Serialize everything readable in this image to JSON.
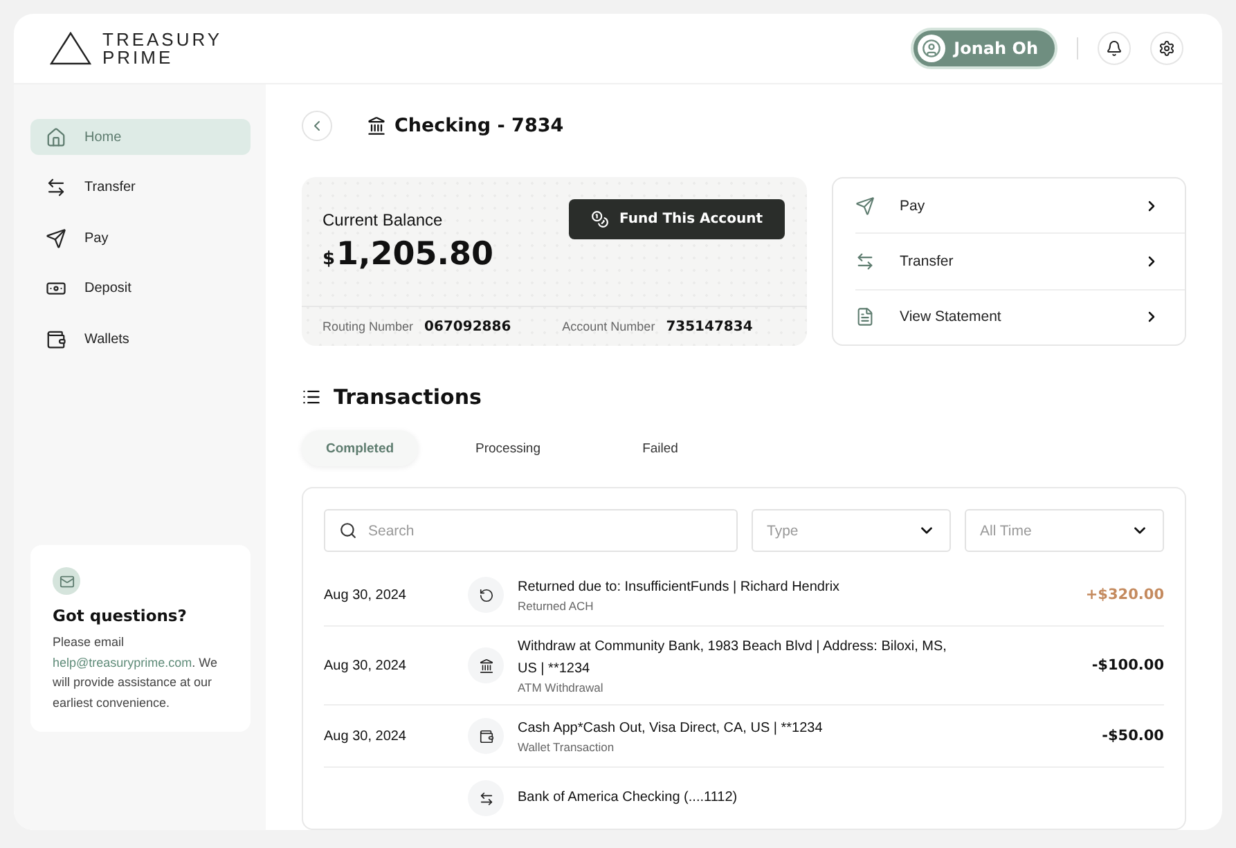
{
  "brand": {
    "line1": "TREASURY",
    "line2": "PRIME"
  },
  "user": {
    "name": "Jonah Oh"
  },
  "sidebar": {
    "items": [
      {
        "label": "Home",
        "kind": "home",
        "selected": true
      },
      {
        "label": "Transfer",
        "kind": "transfer",
        "selected": false
      },
      {
        "label": "Pay",
        "kind": "send",
        "selected": false
      },
      {
        "label": "Deposit",
        "kind": "deposit",
        "selected": false
      },
      {
        "label": "Wallets",
        "kind": "wallet",
        "selected": false
      }
    ],
    "help": {
      "title": "Got questions?",
      "before": "Please email",
      "link": "help@treasuryprime.com",
      "after": ". We will provide assistance at our earliest convenience."
    }
  },
  "account": {
    "title": "Checking - 7834",
    "balance_label": "Current Balance",
    "currency": "$",
    "balance": "1,205.80",
    "fund_button": "Fund This Account",
    "routing_label": "Routing Number",
    "routing": "067092886",
    "account_label": "Account Number",
    "account": "735147834"
  },
  "actions": [
    {
      "label": "Pay",
      "kind": "send"
    },
    {
      "label": "Transfer",
      "kind": "transfer"
    },
    {
      "label": "View Statement",
      "kind": "file"
    }
  ],
  "transactions": {
    "title": "Transactions",
    "tabs": [
      {
        "label": "Completed",
        "selected": true
      },
      {
        "label": "Processing",
        "selected": false
      },
      {
        "label": "Failed",
        "selected": false
      }
    ],
    "search": {
      "placeholder": "Search"
    },
    "filters": [
      {
        "placeholder": "Type"
      },
      {
        "placeholder": "All Time"
      }
    ],
    "rows": [
      {
        "date": "Aug 30, 2024",
        "description": "Returned due to: InsufficientFunds | Richard Hendrix",
        "type": "Returned ACH",
        "amount": "+$320.00",
        "kind": "credit"
      },
      {
        "date": "Aug 30, 2024",
        "description": "Withdraw at Community Bank, 1983 Beach Blvd | Address: Biloxi, MS, US | **1234",
        "type": "ATM Withdrawal",
        "amount": "-$100.00",
        "kind": "debit"
      },
      {
        "date": "Aug 30, 2024",
        "description": "Cash App*Cash Out, Visa Direct, CA, US | **1234",
        "type": "Wallet Transaction",
        "amount": "-$50.00",
        "kind": "debit"
      },
      {
        "description": "Bank of America Checking (....1112)"
      }
    ]
  }
}
